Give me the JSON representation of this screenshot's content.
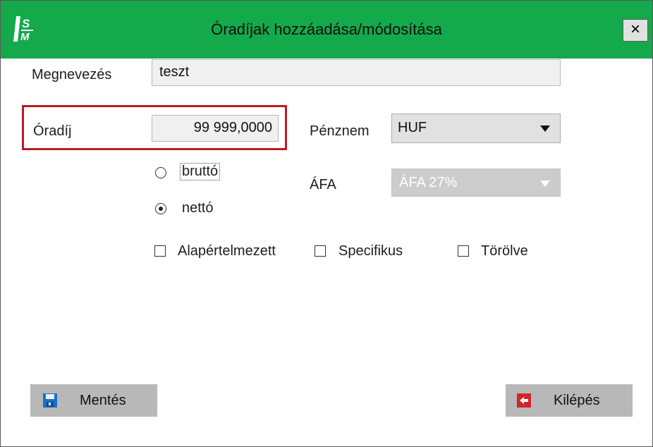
{
  "window": {
    "title": "Óradíjak hozzáadása/módosítása",
    "close_label": "×",
    "accent_color": "#14a94a"
  },
  "form": {
    "name_label": "Megnevezés",
    "name_value": "teszt",
    "rate_label": "Óradíj",
    "rate_value": "99 999,0000",
    "currency_label": "Pénznem",
    "currency_value": "HUF",
    "vat_label": "ÁFA",
    "vat_value": "ÁFA 27%",
    "gross_label": "bruttó",
    "net_label": "nettó",
    "selected_basis": "nettó",
    "default_label": "Alapértelmezett",
    "specific_label": "Specifikus",
    "deleted_label": "Törölve"
  },
  "buttons": {
    "save_label": "Mentés",
    "exit_label": "Kilépés"
  },
  "icons": {
    "app_logo": "ism-logo",
    "dropdown": "chevron-down-icon",
    "save": "floppy-disk-icon",
    "exit": "exit-door-icon"
  }
}
